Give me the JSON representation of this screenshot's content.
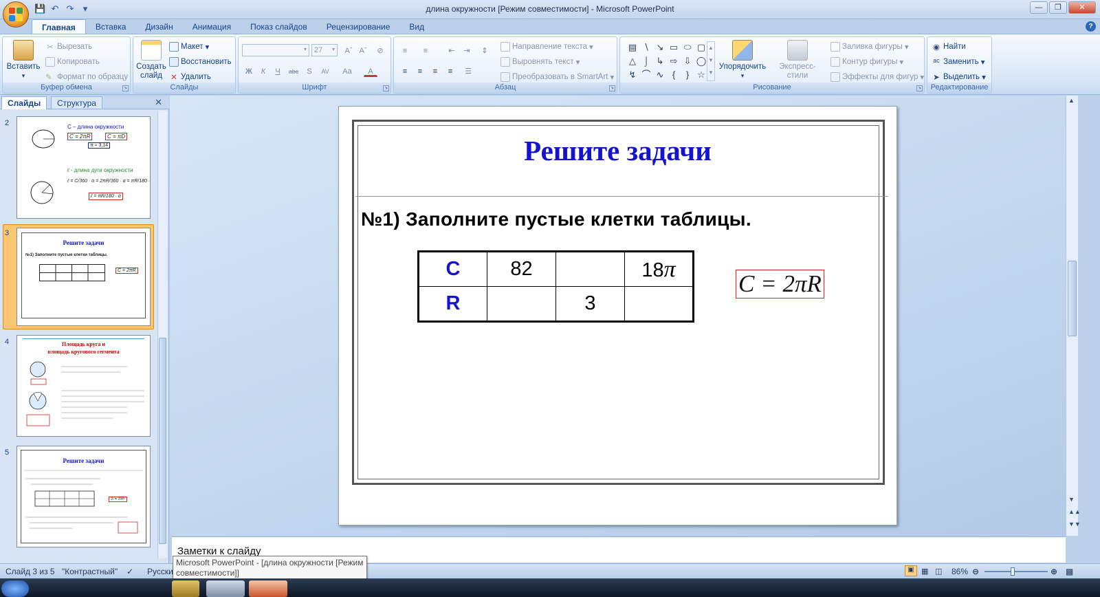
{
  "window": {
    "title": "длина окружности [Режим совместимости] - Microsoft PowerPoint"
  },
  "tabs": [
    "Главная",
    "Вставка",
    "Дизайн",
    "Анимация",
    "Показ слайдов",
    "Рецензирование",
    "Вид"
  ],
  "ribbon": {
    "clipboard": {
      "label": "Буфер обмена",
      "paste": "Вставить",
      "cut": "Вырезать",
      "copy": "Копировать",
      "format_painter": "Формат по образцу"
    },
    "slides": {
      "label": "Слайды",
      "new_slide_line1": "Создать",
      "new_slide_line2": "слайд",
      "layout": "Макет",
      "reset": "Восстановить",
      "delete": "Удалить"
    },
    "font": {
      "label": "Шрифт",
      "size": "27"
    },
    "paragraph": {
      "label": "Абзац",
      "text_direction": "Направление текста",
      "align_text": "Выровнять текст",
      "smartart": "Преобразовать в SmartArt"
    },
    "drawing": {
      "label": "Рисование",
      "arrange": "Упорядочить",
      "quick_styles": "Экспресс-стили",
      "shape_fill": "Заливка фигуры",
      "shape_outline": "Контур фигуры",
      "shape_effects": "Эффекты для фигур"
    },
    "editing": {
      "label": "Редактирование",
      "find": "Найти",
      "replace": "Заменить",
      "select": "Выделить"
    }
  },
  "panel": {
    "tab_slides": "Слайды",
    "tab_outline": "Структура",
    "thumbnails": [
      {
        "number": "2",
        "line1": "C – длина окружности",
        "f1": "C = 2πR",
        "f2": "C = πD",
        "f3": "π ≈ 3,14",
        "line2": "ℓ  - длина дуги окружности"
      },
      {
        "number": "3",
        "title": "Решите задачи",
        "task": "№1) Заполните  пустые  клетки  таблицы.",
        "formula": "C = 2πR"
      },
      {
        "number": "4",
        "title1": "Площадь  круга и",
        "title2": "площадь  кругового  сегмента"
      },
      {
        "number": "5",
        "title": "Решите задачи",
        "formula": "S = πR²"
      }
    ]
  },
  "slide": {
    "title": "Решите задачи",
    "task": "№1) Заполните  пустые  клетки  таблицы.",
    "table": {
      "rows": [
        [
          "C",
          "82",
          "",
          "18"
        ],
        [
          "R",
          "",
          "3",
          ""
        ]
      ],
      "pi_symbol": "π"
    },
    "formula": "C = 2πR"
  },
  "notes": {
    "placeholder": "Заметки к слайду"
  },
  "status": {
    "slide_counter": "Слайд 3 из 5",
    "theme": "\"Контрастный\"",
    "language": "Русски",
    "zoom": "86%"
  },
  "tooltip": {
    "line1": "Microsoft PowerPoint - [длина окружности [Режим",
    "line2": "совместимости]]"
  },
  "colors": {
    "title_blue": "#1414cc",
    "formula_border": "#dd2222",
    "ribbon_bg": "#dbe8f7"
  }
}
